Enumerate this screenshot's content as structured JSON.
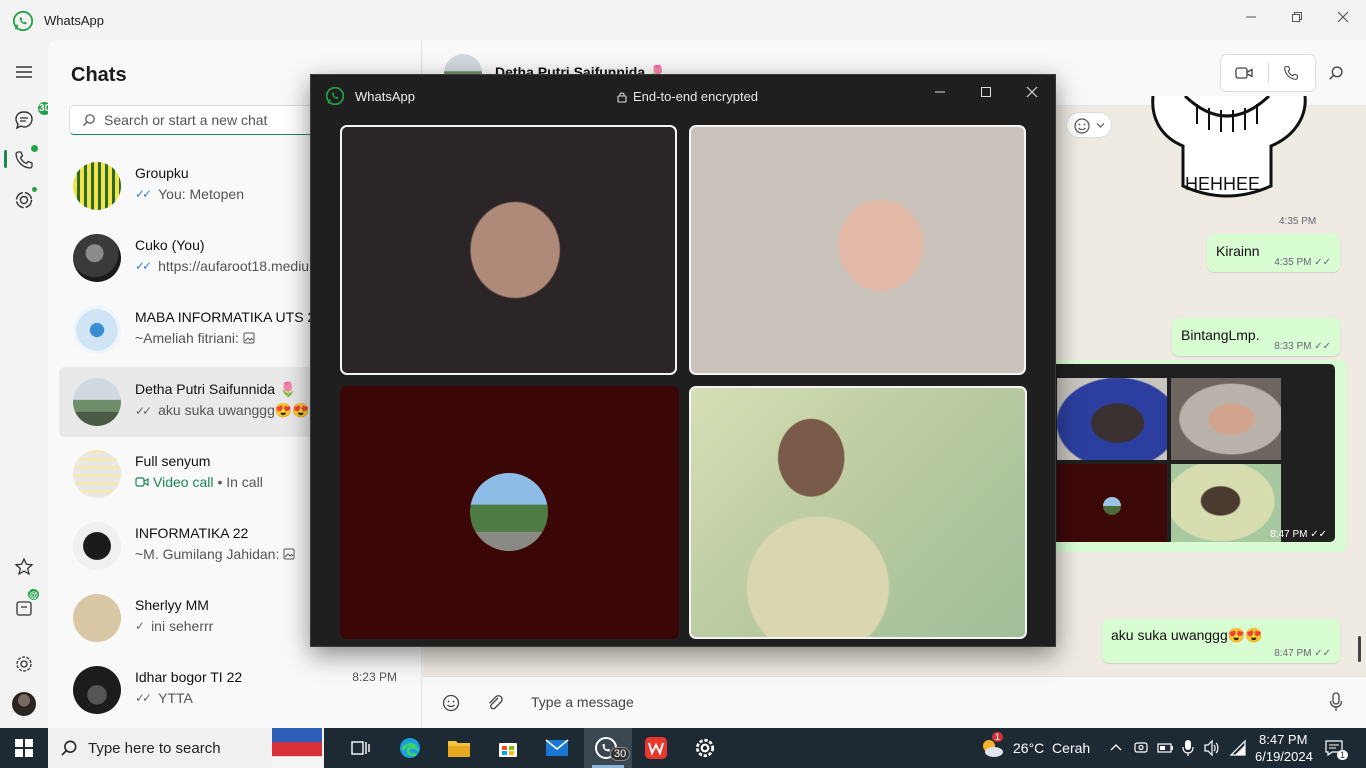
{
  "titlebar": {
    "app_name": "WhatsApp"
  },
  "rail": {
    "chats_badge": "30",
    "tools_badge": "@"
  },
  "chatlist": {
    "title": "Chats",
    "search_placeholder": "Search or start a new chat",
    "items": [
      {
        "name": "Groupku",
        "preview": "You: Metopen",
        "time": ""
      },
      {
        "name": "Cuko (You)",
        "preview": "https://aufaroot18.mediu",
        "time": ""
      },
      {
        "name": "MABA INFORMATIKA UTS 2",
        "preview": "~Ameliah fitriani:",
        "time": ""
      },
      {
        "name": "Detha Putri Saifunnida 🌷",
        "preview": "aku suka uwanggg😍😍",
        "time": ""
      },
      {
        "name": "Full senyum",
        "preview_call": "Video call",
        "preview_status": "• In call",
        "time": ""
      },
      {
        "name": "INFORMATIKA 22",
        "preview": "~M. Gumilang Jahidan:",
        "time": ""
      },
      {
        "name": "Sherlyy MM",
        "preview": "ini seherrr",
        "time": ""
      },
      {
        "name": "Idhar bogor TI 22",
        "preview": "YTTA",
        "time": "8:23 PM"
      }
    ]
  },
  "conversation": {
    "contact_name": "Detha Putri Saifunnida 🌷",
    "sticker_text": "HEHHEE",
    "sticker_time": "4:35 PM",
    "messages": [
      {
        "text": "Kirainn",
        "time": "4:35 PM"
      },
      {
        "text": "BintangLmp.",
        "time": "8:33 PM"
      },
      {
        "text": "aku suka uwanggg😍😍",
        "time": "8:47 PM"
      }
    ],
    "image_time": "8:47 PM",
    "compose_placeholder": "Type a message"
  },
  "call_window": {
    "title": "WhatsApp",
    "encryption_label": "End-to-end encrypted"
  },
  "taskbar": {
    "search_placeholder": "Type here to search",
    "whatsapp_badge": "30",
    "weather": "26°C  Cerah",
    "weather_alert": "1",
    "time": "8:47 PM",
    "date": "6/19/2024",
    "notifications": "1"
  },
  "colors": {
    "accent": "#1b8755",
    "bubble": "#d9fdd3",
    "badge": "#25a244",
    "call_bg": "#1f1f1f"
  }
}
